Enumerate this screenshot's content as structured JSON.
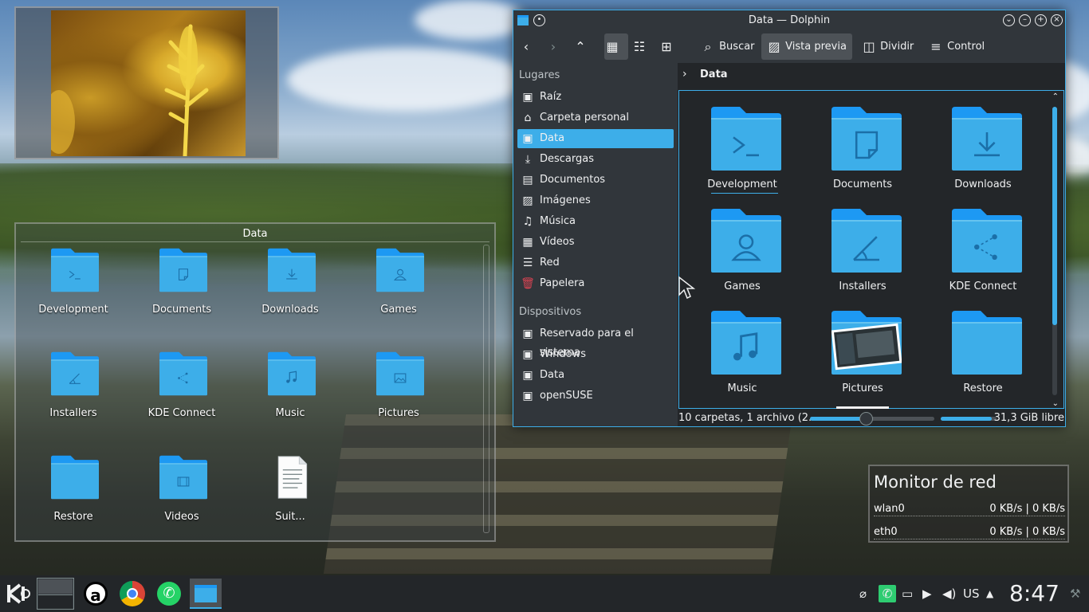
{
  "photo_widget": {},
  "folder_widget": {
    "title": "Data",
    "items": [
      {
        "label": "Development",
        "icon": "terminal-folder-icon"
      },
      {
        "label": "Documents",
        "icon": "documents-folder-icon"
      },
      {
        "label": "Downloads",
        "icon": "downloads-folder-icon"
      },
      {
        "label": "Games",
        "icon": "games-folder-icon"
      },
      {
        "label": "Installers",
        "icon": "installers-folder-icon"
      },
      {
        "label": "KDE Connect",
        "icon": "kdeconnect-folder-icon"
      },
      {
        "label": "Music",
        "icon": "music-folder-icon"
      },
      {
        "label": "Pictures",
        "icon": "pictures-folder-icon"
      },
      {
        "label": "Restore",
        "icon": "folder-icon"
      },
      {
        "label": "Videos",
        "icon": "videos-folder-icon"
      },
      {
        "label": "Suit...",
        "icon": "text-file-icon"
      }
    ]
  },
  "dolphin": {
    "title": "Data — Dolphin",
    "toolbar": {
      "search": "Buscar",
      "preview": "Vista previa",
      "split": "Dividir",
      "control": "Control"
    },
    "places_header": "Lugares",
    "places": [
      "Raíz",
      "Carpeta personal",
      "Data",
      "Descargas",
      "Documentos",
      "Imágenes",
      "Música",
      "Vídeos",
      "Red",
      "Papelera"
    ],
    "places_selected": "Data",
    "devices_header": "Dispositivos",
    "devices": [
      "Reservado para el sistema",
      "Windows",
      "Data",
      "openSUSE"
    ],
    "breadcrumb": "Data",
    "items": [
      {
        "label": "Development",
        "icon": "terminal-folder-icon"
      },
      {
        "label": "Documents",
        "icon": "documents-folder-icon"
      },
      {
        "label": "Downloads",
        "icon": "downloads-folder-icon"
      },
      {
        "label": "Games",
        "icon": "games-folder-icon"
      },
      {
        "label": "Installers",
        "icon": "installers-folder-icon"
      },
      {
        "label": "KDE Connect",
        "icon": "kdeconnect-folder-icon"
      },
      {
        "label": "Music",
        "icon": "music-folder-icon"
      },
      {
        "label": "Pictures",
        "icon": "pictures-folder-icon"
      },
      {
        "label": "Restore",
        "icon": "folder-icon"
      }
    ],
    "status_text": "10 carpetas, 1 archivo (2...",
    "zoom_level": 0.45,
    "free_space": "31,3 GiB libre",
    "free_space_fill": 0.92
  },
  "network_monitor": {
    "title": "Monitor de red",
    "rows": [
      {
        "iface": "wlan0",
        "rate": "0 KB/s | 0 KB/s"
      },
      {
        "iface": "eth0",
        "rate": "0 KB/s | 0 KB/s"
      }
    ]
  },
  "taskbar": {
    "keyboard_layout": "US",
    "clock": "8:47"
  },
  "colors": {
    "accent": "#3daee9",
    "folder": "#3daee9",
    "folder_dark": "#1d99f3",
    "window_bg": "#232629",
    "panel_bg": "#31363b"
  }
}
